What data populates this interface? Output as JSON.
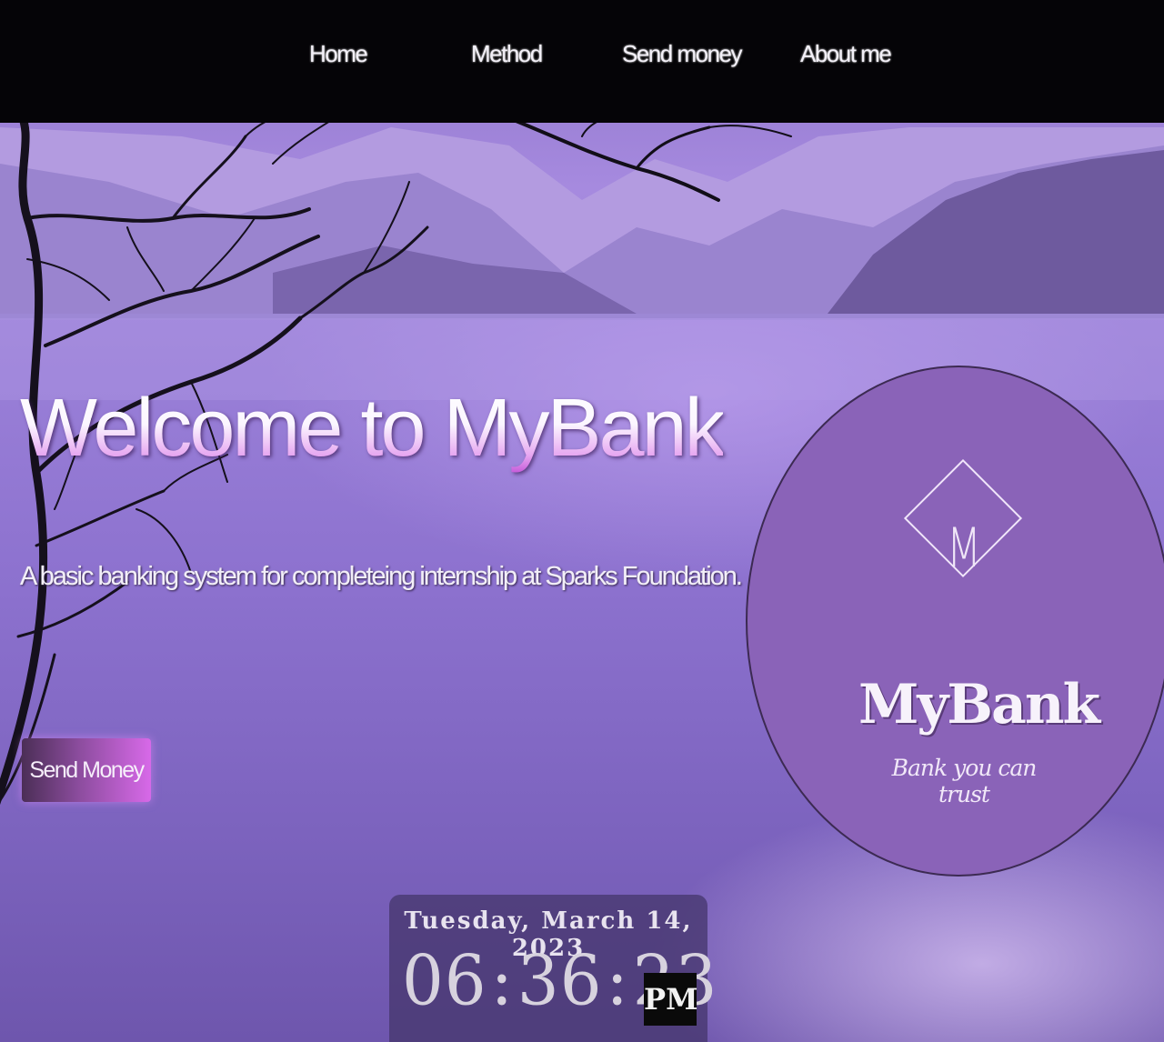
{
  "nav": {
    "items": [
      {
        "label": "Home"
      },
      {
        "label": "Method"
      },
      {
        "label": "Send money"
      },
      {
        "label": "About me"
      }
    ]
  },
  "hero": {
    "title": "Welcome to MyBank",
    "subtitle": "A basic banking system for completeing internship at Sparks Foundation.",
    "send_button_label": "Send Money"
  },
  "logo": {
    "monogram": "M",
    "name": "MyBank",
    "tagline": "Bank you can trust",
    "circle_color": "#8a63b8"
  },
  "clock": {
    "date": "Tuesday, March 14, 2023",
    "hours": "06",
    "minutes": "36",
    "seconds": "23",
    "period": "PM"
  },
  "colors": {
    "accent": "#d769e8",
    "nav_background": "#050407",
    "scene": "#9a80d8"
  }
}
